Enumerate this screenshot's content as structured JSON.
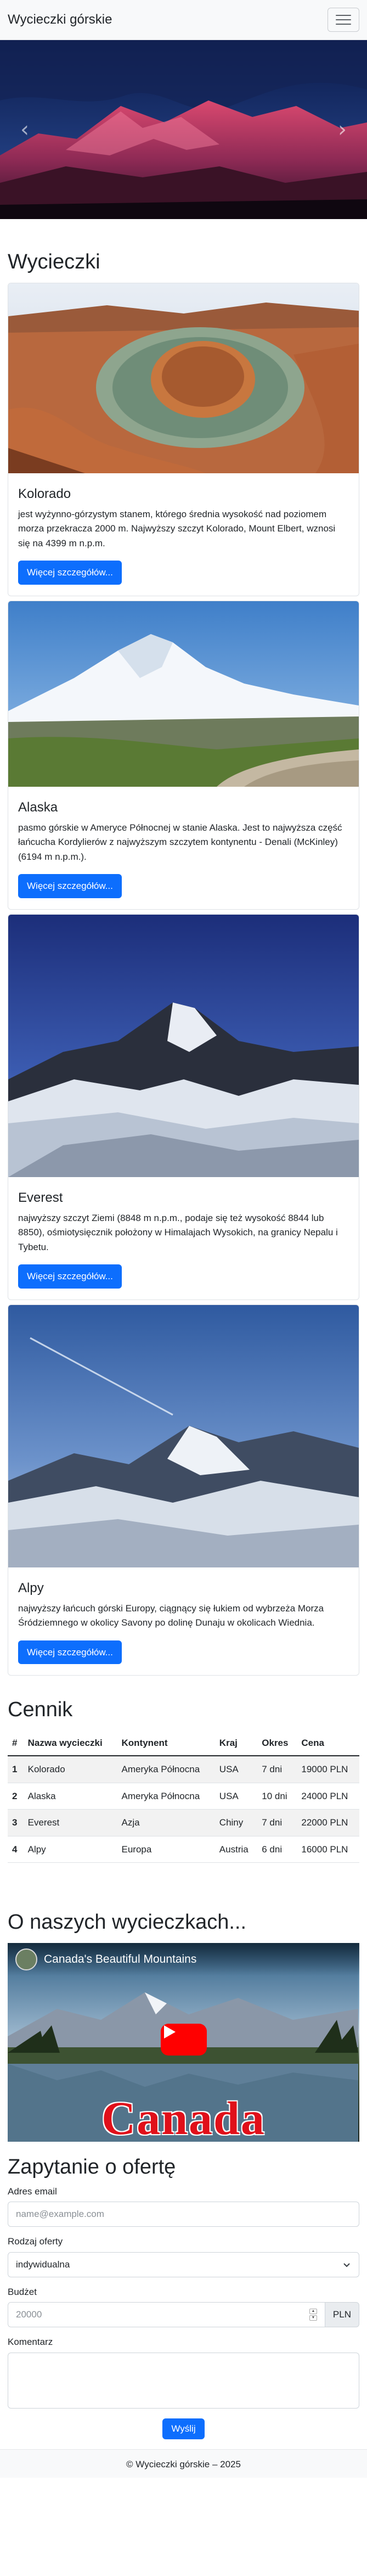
{
  "navbar": {
    "brand": "Wycieczki górskie",
    "toggle_icon": "hamburger-menu-icon"
  },
  "carousel": {
    "prev_icon": "chevron-left-icon",
    "next_icon": "chevron-right-icon"
  },
  "tours": {
    "heading": "Wycieczki",
    "button_label": "Więcej szczegółów...",
    "items": [
      {
        "title": "Kolorado",
        "text": "jest wyżynno-górzystym stanem, którego średnia wysokość nad poziomem morza przekracza 2000 m. Najwyższy szczyt Kolorado, Mount Elbert, wznosi się na 4399 m n.p.m."
      },
      {
        "title": "Alaska",
        "text": "pasmo górskie w Ameryce Północnej w stanie Alaska. Jest to najwyższa część łańcucha Kordylierów z najwyższym szczytem kontynentu - Denali (McKinley) (6194 m n.p.m.)."
      },
      {
        "title": "Everest",
        "text": "najwyższy szczyt Ziemi (8848 m n.p.m., podaje się też wysokość 8844 lub 8850), ośmiotysięcznik położony w Himalajach Wysokich, na granicy Nepalu i Tybetu."
      },
      {
        "title": "Alpy",
        "text": "najwyższy łańcuch górski Europy, ciągnący się łukiem od wybrzeża Morza Śródziemnego w okolicy Savony po dolinę Dunaju w okolicach Wiednia."
      }
    ]
  },
  "pricing": {
    "heading": "Cennik",
    "columns": [
      "#",
      "Nazwa wycieczki",
      "Kontynent",
      "Kraj",
      "Okres",
      "Cena"
    ],
    "rows": [
      [
        "1",
        "Kolorado",
        "Ameryka Północna",
        "USA",
        "7 dni",
        "19000 PLN"
      ],
      [
        "2",
        "Alaska",
        "Ameryka Północna",
        "USA",
        "10 dni",
        "24000 PLN"
      ],
      [
        "3",
        "Everest",
        "Azja",
        "Chiny",
        "7 dni",
        "22000 PLN"
      ],
      [
        "4",
        "Alpy",
        "Europa",
        "Austria",
        "6 dni",
        "16000 PLN"
      ]
    ]
  },
  "about": {
    "heading": "O naszych wycieczkach...",
    "video_title": "Canada's Beautiful Mountains",
    "video_overlay_text": "Canada",
    "play_icon": "play-icon"
  },
  "form": {
    "heading": "Zapytanie o ofertę",
    "email_label": "Adres email",
    "email_placeholder": "name@example.com",
    "type_label": "Rodzaj oferty",
    "type_value": "indywidualna",
    "budget_label": "Budżet",
    "budget_value": "20000",
    "budget_unit": "PLN",
    "comment_label": "Komentarz",
    "submit_label": "Wyślij"
  },
  "footer": {
    "text": "© Wycieczki górskie – 2025"
  },
  "colors": {
    "primary": "#0d6efd",
    "navbar_bg": "#f8f9fa",
    "youtube_red": "#ff0000"
  }
}
